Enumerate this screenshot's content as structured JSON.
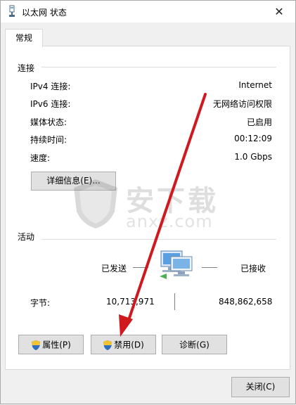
{
  "window": {
    "title": "以太网 状态",
    "close_glyph": "✕"
  },
  "tabs": [
    {
      "label": "常规"
    }
  ],
  "connection": {
    "group_label": "连接",
    "rows": [
      {
        "label": "IPv4 连接:",
        "value": "Internet"
      },
      {
        "label": "IPv6 连接:",
        "value": "无网络访问权限"
      },
      {
        "label": "媒体状态:",
        "value": "已启用"
      },
      {
        "label": "持续时间:",
        "value": "00:12:09"
      },
      {
        "label": "速度:",
        "value": "1.0 Gbps"
      }
    ],
    "details_button": "详细信息(E)..."
  },
  "activity": {
    "group_label": "活动",
    "sent_label": "已发送",
    "received_label": "已接收",
    "bytes_label": "字节:",
    "bytes_sent": "10,713,971",
    "bytes_received": "848,862,658"
  },
  "buttons": {
    "properties": "属性(P)",
    "disable": "禁用(D)",
    "diagnose": "诊断(G)",
    "close": "关闭(C)"
  },
  "watermark": {
    "text": "安下载",
    "subtext": "anxz.com"
  },
  "colors": {
    "arrow": "#d0181f",
    "shield_blue": "#2f6fc0",
    "shield_yellow": "#f2c230"
  },
  "icons": [
    "network-adapter-icon",
    "shield-icon",
    "network-computers-icon",
    "close-icon"
  ]
}
